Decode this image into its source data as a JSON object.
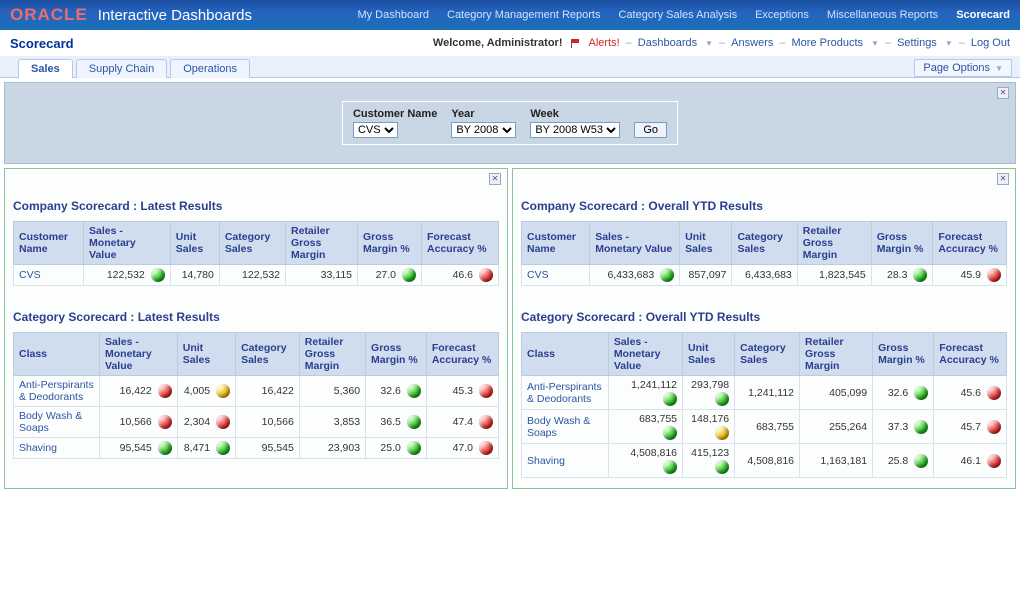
{
  "brand": {
    "logo": "ORACLE",
    "sub": "Interactive Dashboards"
  },
  "topnav": [
    {
      "label": "My Dashboard",
      "active": false
    },
    {
      "label": "Category Management Reports",
      "active": false
    },
    {
      "label": "Category Sales Analysis",
      "active": false
    },
    {
      "label": "Exceptions",
      "active": false
    },
    {
      "label": "Miscellaneous Reports",
      "active": false
    },
    {
      "label": "Scorecard",
      "active": true
    }
  ],
  "subheader": {
    "title": "Scorecard",
    "welcome": "Welcome, Administrator!",
    "links": {
      "alerts": "Alerts!",
      "dashboards": "Dashboards",
      "answers": "Answers",
      "more": "More Products",
      "settings": "Settings",
      "logout": "Log Out"
    }
  },
  "tabs": [
    {
      "label": "Sales",
      "active": true
    },
    {
      "label": "Supply Chain",
      "active": false
    },
    {
      "label": "Operations",
      "active": false
    }
  ],
  "page_options_label": "Page Options",
  "filters": {
    "customer": {
      "label": "Customer Name",
      "value": "CVS"
    },
    "year": {
      "label": "Year",
      "value": "BY 2008"
    },
    "week": {
      "label": "Week",
      "value": "BY 2008 W53"
    },
    "go": "Go"
  },
  "columns": {
    "customer": "Customer Name",
    "class": "Class",
    "smv": "Sales - Monetary Value",
    "unit": "Unit Sales",
    "cat": "Category Sales",
    "rgm": "Retailer Gross Margin",
    "gmp": "Gross Margin %",
    "fa": "Forecast Accuracy %"
  },
  "left": {
    "company": {
      "title": "Company Scorecard : Latest Results",
      "row": {
        "name": "CVS",
        "smv": "122,532",
        "smv_ind": "g",
        "unit": "14,780",
        "cat": "122,532",
        "rgm": "33,115",
        "gmp": "27.0",
        "gmp_ind": "g",
        "fa": "46.6",
        "fa_ind": "r"
      }
    },
    "category": {
      "title": "Category Scorecard : Latest Results",
      "rows": [
        {
          "class": "Anti-Perspirants & Deodorants",
          "smv": "16,422",
          "smv_ind": "r",
          "unit": "4,005",
          "unit_ind": "y",
          "cat": "16,422",
          "rgm": "5,360",
          "gmp": "32.6",
          "gmp_ind": "g",
          "fa": "45.3",
          "fa_ind": "r"
        },
        {
          "class": "Body Wash & Soaps",
          "smv": "10,566",
          "smv_ind": "r",
          "unit": "2,304",
          "unit_ind": "r",
          "cat": "10,566",
          "rgm": "3,853",
          "gmp": "36.5",
          "gmp_ind": "g",
          "fa": "47.4",
          "fa_ind": "r"
        },
        {
          "class": "Shaving",
          "smv": "95,545",
          "smv_ind": "g",
          "unit": "8,471",
          "unit_ind": "g",
          "cat": "95,545",
          "rgm": "23,903",
          "gmp": "25.0",
          "gmp_ind": "g",
          "fa": "47.0",
          "fa_ind": "r"
        }
      ]
    }
  },
  "right": {
    "company": {
      "title": "Company Scorecard : Overall YTD Results",
      "row": {
        "name": "CVS",
        "smv": "6,433,683",
        "smv_ind": "g",
        "unit": "857,097",
        "cat": "6,433,683",
        "rgm": "1,823,545",
        "gmp": "28.3",
        "gmp_ind": "g",
        "fa": "45.9",
        "fa_ind": "r"
      }
    },
    "category": {
      "title": "Category Scorecard : Overall YTD Results",
      "rows": [
        {
          "class": "Anti-Perspirants & Deodorants",
          "smv": "1,241,112",
          "smv_ind": "g",
          "unit": "293,798",
          "unit_ind": "g",
          "cat": "1,241,112",
          "rgm": "405,099",
          "gmp": "32.6",
          "gmp_ind": "g",
          "fa": "45.6",
          "fa_ind": "r"
        },
        {
          "class": "Body Wash & Soaps",
          "smv": "683,755",
          "smv_ind": "g",
          "unit": "148,176",
          "unit_ind": "y",
          "cat": "683,755",
          "rgm": "255,264",
          "gmp": "37.3",
          "gmp_ind": "g",
          "fa": "45.7",
          "fa_ind": "r"
        },
        {
          "class": "Shaving",
          "smv": "4,508,816",
          "smv_ind": "g",
          "unit": "415,123",
          "unit_ind": "g",
          "cat": "4,508,816",
          "rgm": "1,163,181",
          "gmp": "25.8",
          "gmp_ind": "g",
          "fa": "46.1",
          "fa_ind": "r"
        }
      ]
    }
  }
}
